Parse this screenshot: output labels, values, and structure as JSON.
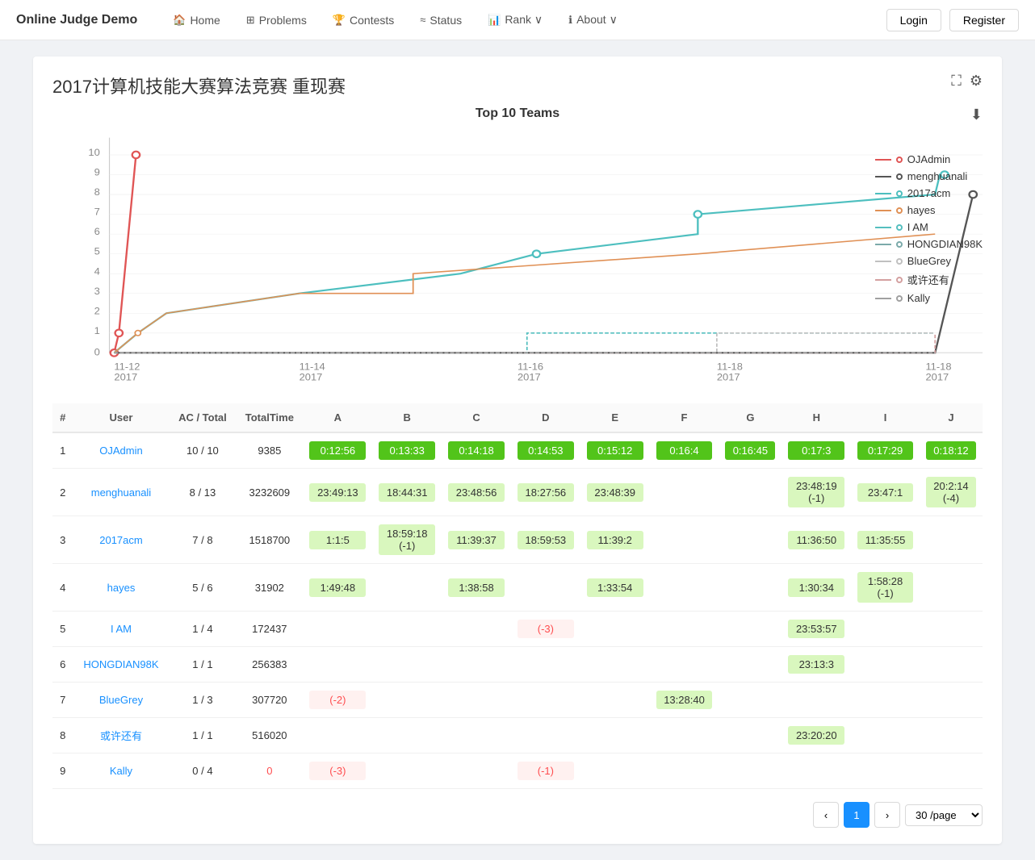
{
  "nav": {
    "brand": "Online Judge Demo",
    "items": [
      {
        "label": "Home",
        "icon": "🏠"
      },
      {
        "label": "Problems",
        "icon": "⊞"
      },
      {
        "label": "Contests",
        "icon": "🏆"
      },
      {
        "label": "Status",
        "icon": "≈"
      },
      {
        "label": "Rank ∨",
        "icon": "📊"
      },
      {
        "label": "About ∨",
        "icon": "ℹ"
      }
    ],
    "login": "Login",
    "register": "Register"
  },
  "contest": {
    "title": "2017计算机技能大赛算法竞赛 重现赛"
  },
  "chart": {
    "title": "Top 10 Teams",
    "download_icon": "⬇",
    "legend": [
      {
        "name": "OJAdmin",
        "color": "#e05555"
      },
      {
        "name": "menghuanali",
        "color": "#555"
      },
      {
        "name": "2017acm",
        "color": "#4dbfbf"
      },
      {
        "name": "hayes",
        "color": "#e09055"
      },
      {
        "name": "I AM",
        "color": "#55bfbf"
      },
      {
        "name": "HONGDIAN98K",
        "color": "#7baaaa"
      },
      {
        "name": "BlueGrey",
        "color": "#c0c0c0"
      },
      {
        "name": "或许还有",
        "color": "#d4a0a0"
      },
      {
        "name": "Kally",
        "color": "#a0a0a0"
      }
    ]
  },
  "table": {
    "headers": [
      "#",
      "User",
      "AC / Total",
      "TotalTime",
      "A",
      "B",
      "C",
      "D",
      "E",
      "F",
      "G",
      "H",
      "I",
      "J"
    ],
    "rows": [
      {
        "rank": 1,
        "user": "OJAdmin",
        "ac_total": "10 / 10",
        "total_time": "9385",
        "cells": [
          {
            "val": "0:12:56",
            "type": "green"
          },
          {
            "val": "0:13:33",
            "type": "green"
          },
          {
            "val": "0:14:18",
            "type": "green"
          },
          {
            "val": "0:14:53",
            "type": "green"
          },
          {
            "val": "0:15:12",
            "type": "green"
          },
          {
            "val": "0:16:4",
            "type": "green"
          },
          {
            "val": "0:16:45",
            "type": "green"
          },
          {
            "val": "0:17:3",
            "type": "green"
          },
          {
            "val": "0:17:29",
            "type": "green"
          },
          {
            "val": "0:18:12",
            "type": "green"
          }
        ]
      },
      {
        "rank": 2,
        "user": "menghuanali",
        "ac_total": "8 / 13",
        "total_time": "3232609",
        "cells": [
          {
            "val": "23:49:13",
            "type": "light-green"
          },
          {
            "val": "18:44:31",
            "type": "light-green"
          },
          {
            "val": "23:48:56",
            "type": "light-green"
          },
          {
            "val": "18:27:56",
            "type": "light-green"
          },
          {
            "val": "23:48:39",
            "type": "light-green"
          },
          {
            "val": "",
            "type": "none"
          },
          {
            "val": "",
            "type": "none"
          },
          {
            "val": "23:48:19\n(-1)",
            "type": "light-green"
          },
          {
            "val": "23:47:1",
            "type": "light-green"
          },
          {
            "val": "20:2:14\n(-4)",
            "type": "light-green"
          }
        ]
      },
      {
        "rank": 3,
        "user": "2017acm",
        "ac_total": "7 / 8",
        "total_time": "1518700",
        "cells": [
          {
            "val": "1:1:5",
            "type": "light-green"
          },
          {
            "val": "18:59:18\n(-1)",
            "type": "light-green"
          },
          {
            "val": "11:39:37",
            "type": "light-green"
          },
          {
            "val": "18:59:53",
            "type": "light-green"
          },
          {
            "val": "11:39:2",
            "type": "light-green"
          },
          {
            "val": "",
            "type": "none"
          },
          {
            "val": "",
            "type": "none"
          },
          {
            "val": "11:36:50",
            "type": "light-green"
          },
          {
            "val": "11:35:55",
            "type": "light-green"
          },
          {
            "val": "",
            "type": "none"
          }
        ]
      },
      {
        "rank": 4,
        "user": "hayes",
        "ac_total": "5 / 6",
        "total_time": "31902",
        "cells": [
          {
            "val": "1:49:48",
            "type": "light-green"
          },
          {
            "val": "",
            "type": "none"
          },
          {
            "val": "1:38:58",
            "type": "light-green"
          },
          {
            "val": "",
            "type": "none"
          },
          {
            "val": "1:33:54",
            "type": "light-green"
          },
          {
            "val": "",
            "type": "none"
          },
          {
            "val": "",
            "type": "none"
          },
          {
            "val": "1:30:34",
            "type": "light-green"
          },
          {
            "val": "1:58:28\n(-1)",
            "type": "light-green"
          },
          {
            "val": "",
            "type": "none"
          }
        ]
      },
      {
        "rank": 5,
        "user": "I AM",
        "ac_total": "1 / 4",
        "total_time": "172437",
        "cells": [
          {
            "val": "",
            "type": "none"
          },
          {
            "val": "",
            "type": "none"
          },
          {
            "val": "",
            "type": "none"
          },
          {
            "val": "(-3)",
            "type": "red"
          },
          {
            "val": "",
            "type": "none"
          },
          {
            "val": "",
            "type": "none"
          },
          {
            "val": "",
            "type": "none"
          },
          {
            "val": "23:53:57",
            "type": "light-green"
          },
          {
            "val": "",
            "type": "none"
          },
          {
            "val": "",
            "type": "none"
          }
        ]
      },
      {
        "rank": 6,
        "user": "HONGDIAN98K",
        "ac_total": "1 / 1",
        "total_time": "256383",
        "cells": [
          {
            "val": "",
            "type": "none"
          },
          {
            "val": "",
            "type": "none"
          },
          {
            "val": "",
            "type": "none"
          },
          {
            "val": "",
            "type": "none"
          },
          {
            "val": "",
            "type": "none"
          },
          {
            "val": "",
            "type": "none"
          },
          {
            "val": "",
            "type": "none"
          },
          {
            "val": "23:13:3",
            "type": "light-green"
          },
          {
            "val": "",
            "type": "none"
          },
          {
            "val": "",
            "type": "none"
          }
        ]
      },
      {
        "rank": 7,
        "user": "BlueGrey",
        "ac_total": "1 / 3",
        "total_time": "307720",
        "cells": [
          {
            "val": "(-2)",
            "type": "red"
          },
          {
            "val": "",
            "type": "none"
          },
          {
            "val": "",
            "type": "none"
          },
          {
            "val": "",
            "type": "none"
          },
          {
            "val": "",
            "type": "none"
          },
          {
            "val": "13:28:40",
            "type": "light-green"
          },
          {
            "val": "",
            "type": "none"
          },
          {
            "val": "",
            "type": "none"
          },
          {
            "val": "",
            "type": "none"
          },
          {
            "val": "",
            "type": "none"
          }
        ]
      },
      {
        "rank": 8,
        "user": "或许还有",
        "ac_total": "1 / 1",
        "total_time": "516020",
        "cells": [
          {
            "val": "",
            "type": "none"
          },
          {
            "val": "",
            "type": "none"
          },
          {
            "val": "",
            "type": "none"
          },
          {
            "val": "",
            "type": "none"
          },
          {
            "val": "",
            "type": "none"
          },
          {
            "val": "",
            "type": "none"
          },
          {
            "val": "",
            "type": "none"
          },
          {
            "val": "23:20:20",
            "type": "light-green"
          },
          {
            "val": "",
            "type": "none"
          },
          {
            "val": "",
            "type": "none"
          }
        ]
      },
      {
        "rank": 9,
        "user": "Kally",
        "ac_total": "0 / 4",
        "total_time": "0",
        "cells": [
          {
            "val": "(-3)",
            "type": "red"
          },
          {
            "val": "",
            "type": "none"
          },
          {
            "val": "",
            "type": "none"
          },
          {
            "val": "(-1)",
            "type": "red"
          },
          {
            "val": "",
            "type": "none"
          },
          {
            "val": "",
            "type": "none"
          },
          {
            "val": "",
            "type": "none"
          },
          {
            "val": "",
            "type": "none"
          },
          {
            "val": "",
            "type": "none"
          },
          {
            "val": "",
            "type": "none"
          }
        ]
      }
    ]
  },
  "pagination": {
    "prev": "‹",
    "next": "›",
    "current_page": 1,
    "page_size": "30 /page"
  }
}
